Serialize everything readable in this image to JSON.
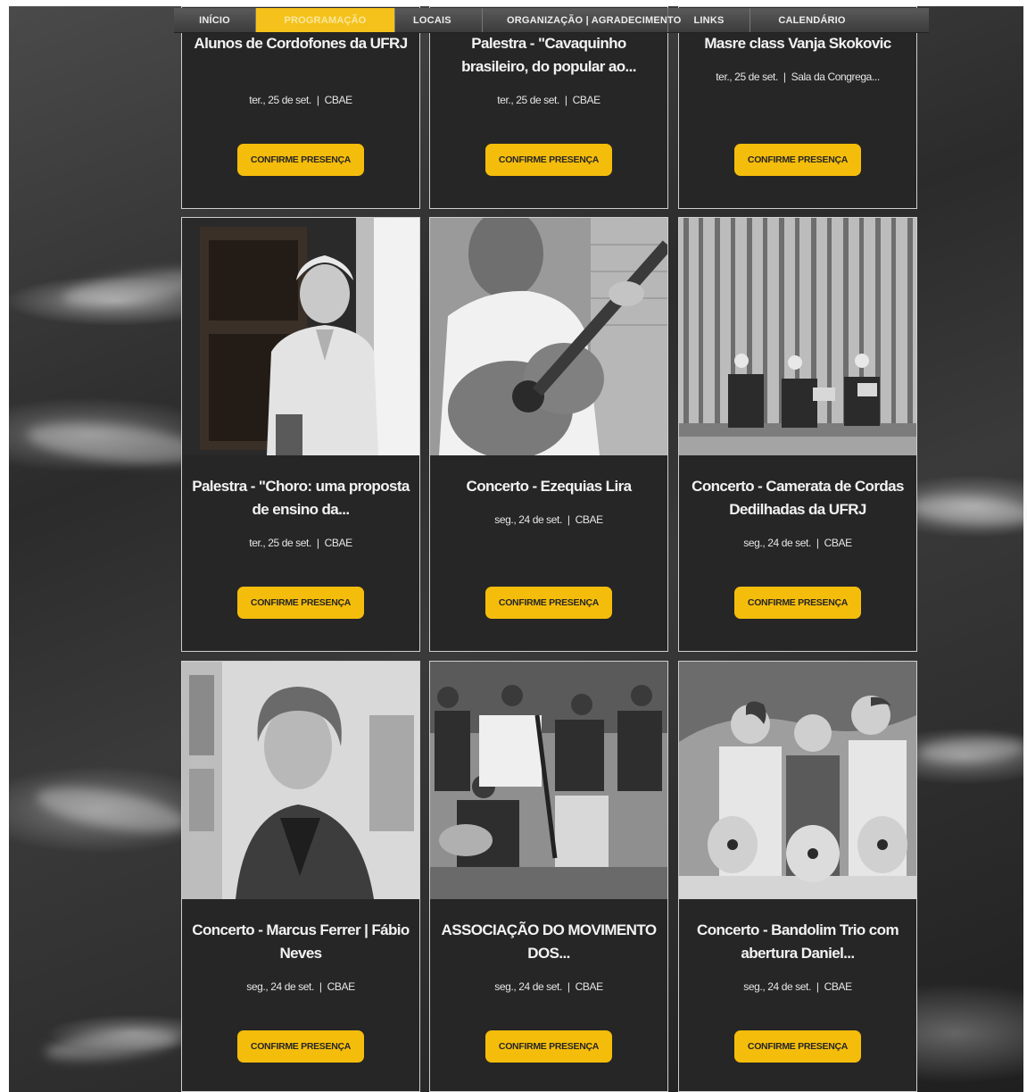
{
  "nav": {
    "items": [
      {
        "label": "INÍCIO",
        "active": false
      },
      {
        "label": "PROGRAMAÇÃO",
        "active": true
      },
      {
        "label": "LOCAIS",
        "active": false
      },
      {
        "label": "ORGANIZAÇÃO | AGRADECIMENTO",
        "active": false
      },
      {
        "label": "LINKS",
        "active": false
      },
      {
        "label": "CALENDÁRIO",
        "active": false
      }
    ]
  },
  "events": [
    {
      "title": "Alunos de Cordofones da UFRJ",
      "date": "ter., 25 de set.",
      "venue": "CBAE",
      "button": "CONFIRME PRESENÇA"
    },
    {
      "title": "Palestra - \"Cavaquinho brasileiro, do popular ao...",
      "date": "ter., 25 de set.",
      "venue": "CBAE",
      "button": "CONFIRME PRESENÇA"
    },
    {
      "title": "Masre class Vanja Skokovic",
      "date": "ter., 25 de set.",
      "venue": "Sala da Congrega...",
      "button": "CONFIRME PRESENÇA"
    },
    {
      "title": "Palestra - \"Choro: uma proposta de ensino da...",
      "date": "ter., 25 de set.",
      "venue": "CBAE",
      "button": "CONFIRME PRESENÇA"
    },
    {
      "title": "Concerto - Ezequias Lira",
      "date": "seg., 24 de set.",
      "venue": "CBAE",
      "button": "CONFIRME PRESENÇA"
    },
    {
      "title": "Concerto - Camerata de Cordas Dedilhadas da UFRJ",
      "date": "seg., 24 de set.",
      "venue": "CBAE",
      "button": "CONFIRME PRESENÇA"
    },
    {
      "title": "Concerto - Marcus Ferrer | Fábio Neves",
      "date": "seg., 24 de set.",
      "venue": "CBAE",
      "button": "CONFIRME PRESENÇA"
    },
    {
      "title": "ASSOCIAÇÃO DO MOVIMENTO DOS...",
      "date": "seg., 24 de set.",
      "venue": "CBAE",
      "button": "CONFIRME PRESENÇA"
    },
    {
      "title": "Concerto - Bandolim Trio com abertura Daniel...",
      "date": "seg., 24 de set.",
      "venue": "CBAE",
      "button": "CONFIRME PRESENÇA"
    }
  ],
  "colors": {
    "accent": "#f5bd0b",
    "card_bg": "#262626"
  },
  "icons": {
    "separator": "|"
  }
}
